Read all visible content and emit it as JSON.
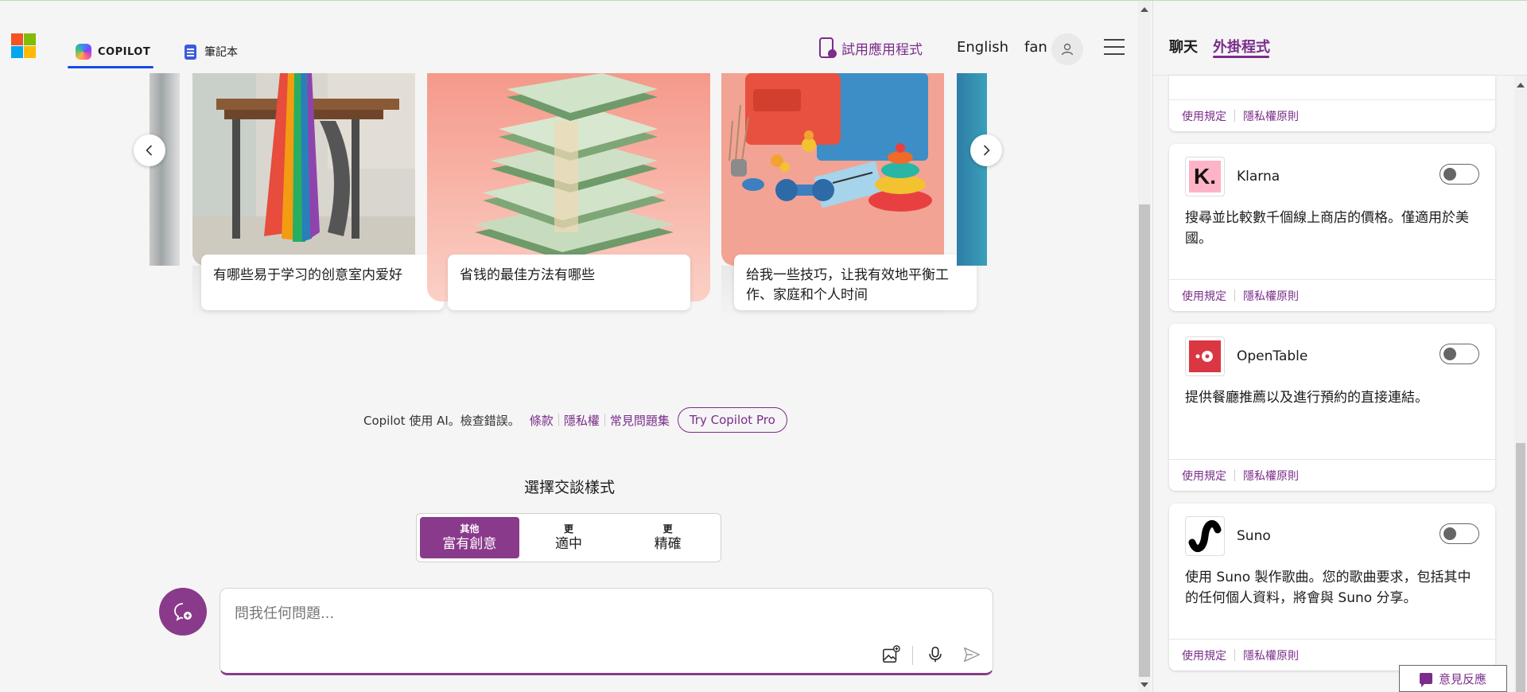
{
  "header": {
    "tab_copilot": "COPILOT",
    "tab_notebook": "筆記本",
    "try_app": "試用應用程式",
    "language": "English",
    "user_name": "fan"
  },
  "carousel": {
    "cards": [
      {
        "caption": "有哪些易于学习的创意室内爱好"
      },
      {
        "caption": "省钱的最佳方法有哪些"
      },
      {
        "caption": "给我一些技巧，让我有效地平衡工作、家庭和个人时间"
      }
    ]
  },
  "footer": {
    "ai_notice": "Copilot 使用 AI。檢查錯誤。",
    "links": [
      "條款",
      "隱私權",
      "常見問題集"
    ],
    "pro_button": "Try Copilot Pro"
  },
  "style": {
    "title": "選擇交談樣式",
    "options": [
      {
        "small": "其他",
        "big": "富有創意",
        "active": true
      },
      {
        "small": "更",
        "big": "適中",
        "active": false
      },
      {
        "small": "更",
        "big": "精確",
        "active": false
      }
    ]
  },
  "input": {
    "placeholder": "問我任何問題..."
  },
  "panel": {
    "tab_chat": "聊天",
    "tab_plugins": "外掛程式",
    "terms_label": "使用規定",
    "privacy_label": "隱私權原則",
    "plugins": [
      {
        "name": "Klarna",
        "description": "搜尋並比較數千個線上商店的價格。僅適用於美國。",
        "enabled": false
      },
      {
        "name": "OpenTable",
        "description": "提供餐廳推薦以及進行預約的直接連結。",
        "enabled": false
      },
      {
        "name": "Suno",
        "description": "使用 Suno 製作歌曲。您的歌曲要求，包括其中的任何個人資料，將會與 Suno 分享。",
        "enabled": false
      }
    ]
  },
  "feedback": "意見反應",
  "colors": {
    "accent": "#7a2d8a",
    "active_style": "#8a3a8a",
    "copilot_underline": "#174ae4"
  }
}
